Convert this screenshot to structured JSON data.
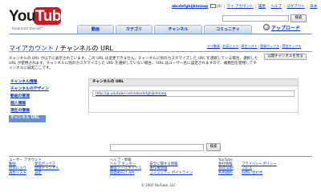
{
  "logo": {
    "part1": "You",
    "part2": "Tube",
    "tagline": "Broadcast Yourself™"
  },
  "toplinks": {
    "username": "abcdefghijklmnop",
    "mail_count": "(0)",
    "items": [
      "マイ アカウント",
      "履歴",
      "ヘルプ",
      "ログアウト",
      "日本"
    ]
  },
  "search": {
    "placeholder": "",
    "button": "検索"
  },
  "nav": {
    "tabs": [
      "動画",
      "カテゴリ",
      "チャンネル",
      "コミュニティ"
    ],
    "upload": "アップロード"
  },
  "page": {
    "title_link": "マイアカウント",
    "title_sep": " / ",
    "title": "チャンネルの URL",
    "subnav": [
      "マイ動画",
      "お気に入り",
      "再生リスト",
      "登録ボックス",
      "受信ボックス"
    ],
    "public_button": "公開チャンネルを見る",
    "description": "チャンネルの URL が以下に表示されています。この URL は変更できません。チャンネルに別のカスタマイズした URL を選択している場合、選択した URL が使用されます。チャンネルに別のカスタマイズした URL を選択していない場合、 URL はユーザー名に設定されますので、複数回を使用してチャンネルに誠実ごこです。"
  },
  "sidebar": {
    "items": [
      {
        "label": "チャンネル情報",
        "active": false
      },
      {
        "label": "チャンネルのデザイン",
        "active": false
      },
      {
        "label": "動画の管理",
        "active": false
      },
      {
        "label": "個人情報",
        "active": false
      },
      {
        "label": "現在の情報",
        "active": false
      },
      {
        "label": "チャンネル URL",
        "active": true
      }
    ]
  },
  "panel": {
    "header": "チャンネルの URL",
    "url": "http://jp.youtube.com/abcdefghijklmnop"
  },
  "footer": {
    "search_button": "検索",
    "col1": {
      "heading": "ユーザー アカウント",
      "a": [
        "動画",
        "お気に入り",
        "再生リスト"
      ],
      "b": [
        "受信ボックス",
        "登録チャンネル",
        "設定"
      ]
    },
    "col2": {
      "heading": "ヘルプ・情報",
      "a": [
        "ヘルプ センター",
        "動画ツールボックス",
        "開発者向け API"
      ],
      "b": [
        "安全に関する情報",
        "著作権情報",
        "コミュニティ ガイドライン"
      ]
    },
    "col3": {
      "heading": "YouTube",
      "a": [
        "会社情報",
        "TestTube",
        "利用規約"
      ],
      "b": [
        "プライバシーポリシー",
        "プレス",
        "お問い合わせ"
      ]
    },
    "copyright": "© 2007 YouTube, LLC"
  }
}
